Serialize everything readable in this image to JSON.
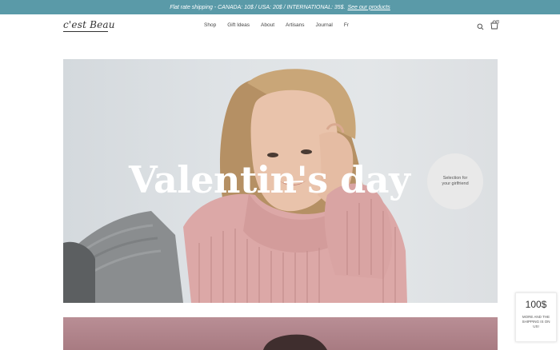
{
  "announcement": {
    "text": "Flat rate shipping - CANADA: 10$ / USA: 20$ / INTERNATIONAL: 35$.",
    "link": "See our products"
  },
  "header": {
    "logo": "c'est Beau",
    "nav": [
      "Shop",
      "Gift Ideas",
      "About",
      "Artisans",
      "Journal",
      "Fr"
    ],
    "cart_count": "0"
  },
  "hero": {
    "title": "Valentin's day",
    "badge": "Selection for your girlfriend"
  },
  "shipping_widget": {
    "amount": "100$",
    "text": "MORE AND THE SHIPPING IS ON US!"
  },
  "colors": {
    "announcement_bg": "#5a9aa8",
    "sweater_pink": "#d9a5a5",
    "second_banner": "#b98e95"
  }
}
